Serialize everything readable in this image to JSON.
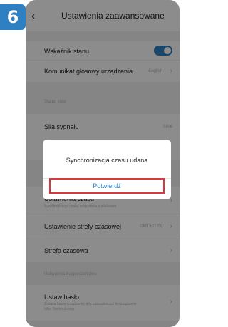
{
  "step": "6",
  "header": {
    "title": "Ustawienia zaawansowane"
  },
  "rows": {
    "status_indicator": {
      "label": "Wskaźnik stanu"
    },
    "voice_message": {
      "label": "Komunikat głosowy urządzenia",
      "value": "English"
    },
    "signal_strength": {
      "label": "Siła sygnału",
      "value": "Silne"
    },
    "time_settings": {
      "label": "Ustawienia czasu",
      "sub": "Synchronizacja czasu urządzenia z telefonem"
    },
    "timezone_settings": {
      "label": "Ustawienie strefy czasowej",
      "value": "GMT+01:00"
    },
    "timezone": {
      "label": "Strefa czasowa"
    },
    "set_password": {
      "label": "Ustaw hasło",
      "sub1": "Zmiana hasła urządzenia, aby zabezpieczyć to urządzenie",
      "sub2": "tylko Twoim dostęp"
    }
  },
  "sections": {
    "device_status": "Status sieci",
    "security": "Ustawienia bezpieczeństwa"
  },
  "dialog": {
    "message": "Synchronizacja czasu udana",
    "confirm": "Potwierdź"
  },
  "colors": {
    "accent": "#2f80c3",
    "highlight": "#d9393b"
  }
}
